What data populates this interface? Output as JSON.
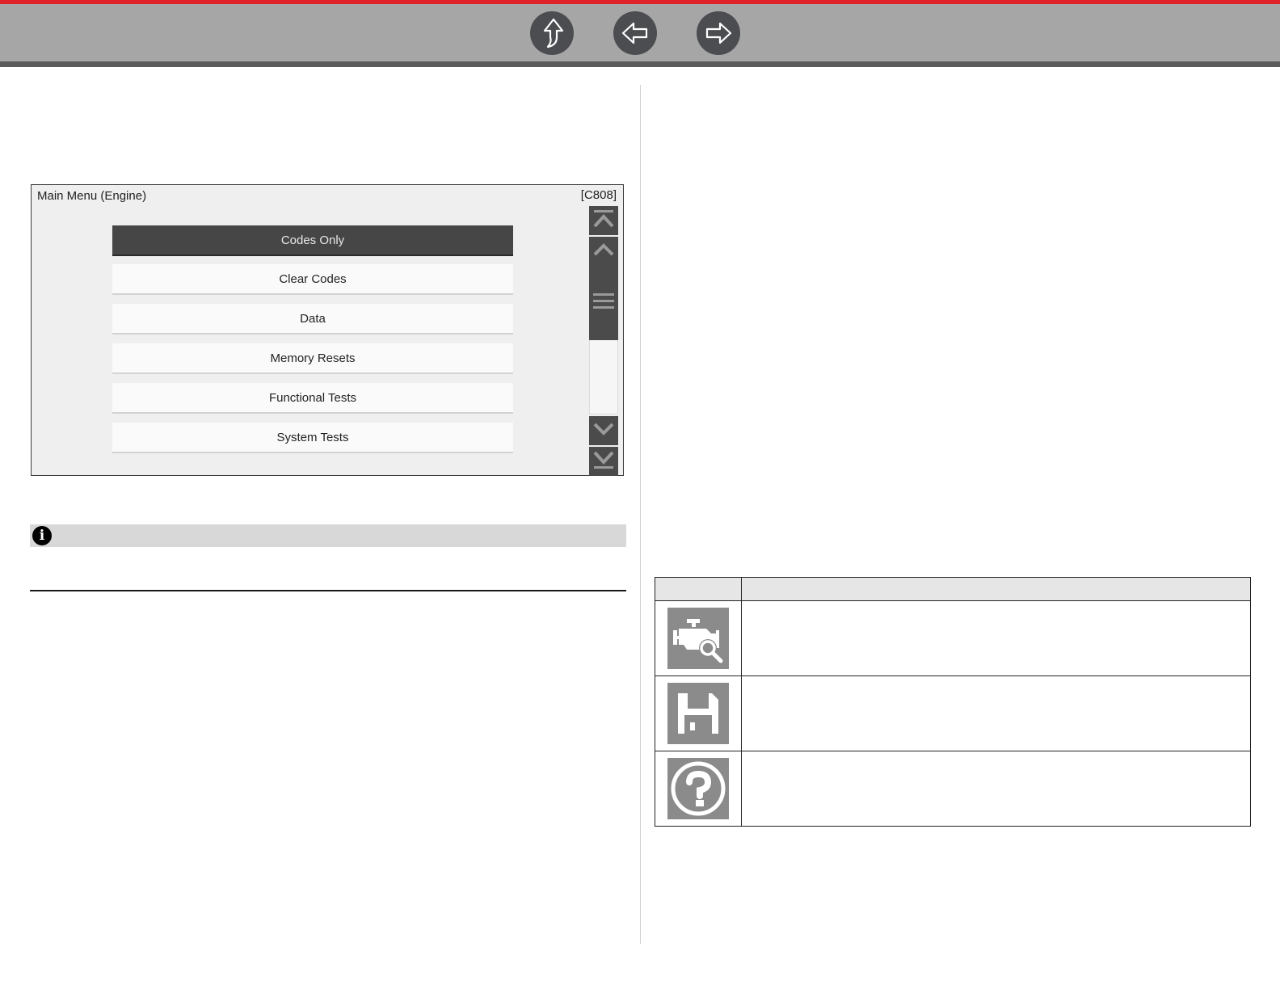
{
  "nav": {
    "buttons": [
      {
        "name": "up",
        "icon": "up-arrow-icon"
      },
      {
        "name": "back",
        "icon": "left-arrow-icon"
      },
      {
        "name": "forward",
        "icon": "right-arrow-icon"
      }
    ],
    "accent_color": "#e0222b"
  },
  "screen": {
    "title": "Main Menu (Engine)",
    "code": "[C808]",
    "menu_items": [
      {
        "label": "Codes Only",
        "selected": true
      },
      {
        "label": "Clear Codes",
        "selected": false
      },
      {
        "label": "Data",
        "selected": false
      },
      {
        "label": "Memory Resets",
        "selected": false
      },
      {
        "label": "Functional Tests",
        "selected": false
      },
      {
        "label": "System Tests",
        "selected": false
      }
    ],
    "scroll_position": 0,
    "scrollbar_icons": [
      "scroll-top-icon",
      "scroll-up-icon",
      "scroll-thumb-grip-icon",
      "scroll-down-icon",
      "scroll-bottom-icon"
    ]
  },
  "note": {
    "icon": "info-icon",
    "text": ""
  },
  "icon_table": {
    "headers": [
      "",
      ""
    ],
    "rows": [
      {
        "icon": "engine-search-icon",
        "description": ""
      },
      {
        "icon": "save-disk-icon",
        "description": ""
      },
      {
        "icon": "help-question-icon",
        "description": ""
      }
    ]
  }
}
